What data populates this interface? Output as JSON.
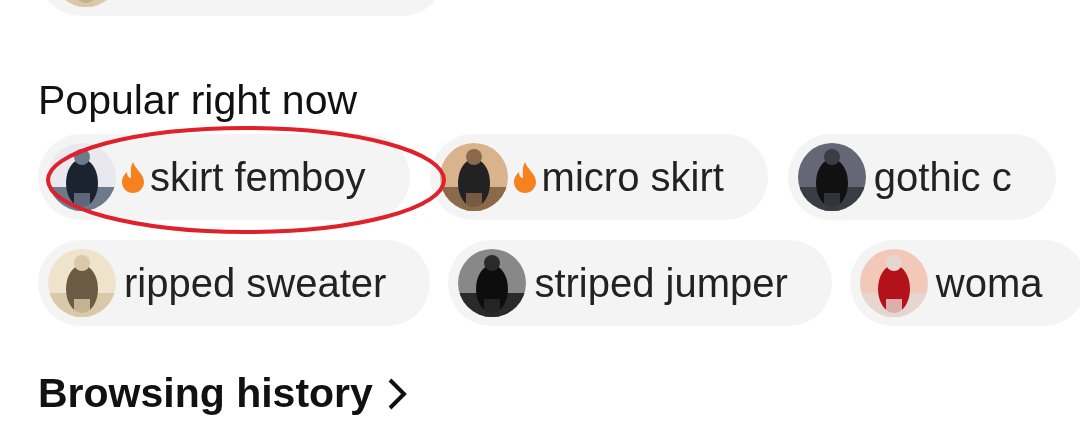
{
  "section_title": "Popular right now",
  "rows": [
    [
      {
        "label": "skirt femboy",
        "hot": true,
        "highlighted": true
      },
      {
        "label": "micro skirt",
        "hot": true,
        "highlighted": false
      },
      {
        "label": "gothic c",
        "hot": false,
        "highlighted": false
      }
    ],
    [
      {
        "label": "ripped sweater",
        "hot": false,
        "highlighted": false
      },
      {
        "label": "striped jumper",
        "hot": false,
        "highlighted": false
      },
      {
        "label": "woma",
        "hot": false,
        "highlighted": false
      }
    ]
  ],
  "next_section_title": "Browsing history"
}
